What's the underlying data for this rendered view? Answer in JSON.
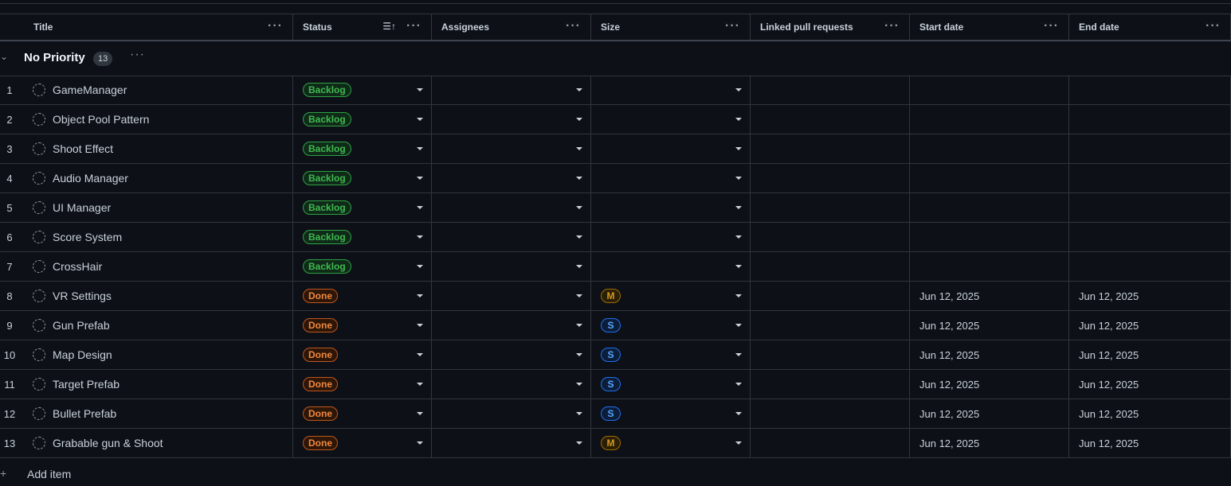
{
  "columns": {
    "title": "Title",
    "status": "Status",
    "assignees": "Assignees",
    "size": "Size",
    "linked": "Linked pull requests",
    "start": "Start date",
    "end": "End date",
    "menu_glyph": "···",
    "sort_glyph": "☰↑"
  },
  "group": {
    "chevron": "⌄",
    "title": "No Priority",
    "count": "13",
    "menu_glyph": "···"
  },
  "colors": {
    "background": "#0d1117",
    "backlog": "#3fb950",
    "done": "#f0883e",
    "size_m": "#d29922",
    "size_s": "#58a6ff"
  },
  "items": [
    {
      "num": "1",
      "title": "GameManager",
      "status": "Backlog",
      "size": "",
      "start": "",
      "end": ""
    },
    {
      "num": "2",
      "title": "Object Pool Pattern",
      "status": "Backlog",
      "size": "",
      "start": "",
      "end": ""
    },
    {
      "num": "3",
      "title": "Shoot Effect",
      "status": "Backlog",
      "size": "",
      "start": "",
      "end": ""
    },
    {
      "num": "4",
      "title": "Audio Manager",
      "status": "Backlog",
      "size": "",
      "start": "",
      "end": ""
    },
    {
      "num": "5",
      "title": "UI Manager",
      "status": "Backlog",
      "size": "",
      "start": "",
      "end": ""
    },
    {
      "num": "6",
      "title": "Score System",
      "status": "Backlog",
      "size": "",
      "start": "",
      "end": ""
    },
    {
      "num": "7",
      "title": "CrossHair",
      "status": "Backlog",
      "size": "",
      "start": "",
      "end": ""
    },
    {
      "num": "8",
      "title": "VR Settings",
      "status": "Done",
      "size": "M",
      "start": "Jun 12, 2025",
      "end": "Jun 12, 2025"
    },
    {
      "num": "9",
      "title": "Gun Prefab",
      "status": "Done",
      "size": "S",
      "start": "Jun 12, 2025",
      "end": "Jun 12, 2025"
    },
    {
      "num": "10",
      "title": "Map Design",
      "status": "Done",
      "size": "S",
      "start": "Jun 12, 2025",
      "end": "Jun 12, 2025"
    },
    {
      "num": "11",
      "title": "Target Prefab",
      "status": "Done",
      "size": "S",
      "start": "Jun 12, 2025",
      "end": "Jun 12, 2025"
    },
    {
      "num": "12",
      "title": "Bullet Prefab",
      "status": "Done",
      "size": "S",
      "start": "Jun 12, 2025",
      "end": "Jun 12, 2025"
    },
    {
      "num": "13",
      "title": "Grabable gun & Shoot",
      "status": "Done",
      "size": "M",
      "start": "Jun 12, 2025",
      "end": "Jun 12, 2025"
    }
  ],
  "add_item": {
    "plus_glyph": "+",
    "label": "Add item"
  }
}
